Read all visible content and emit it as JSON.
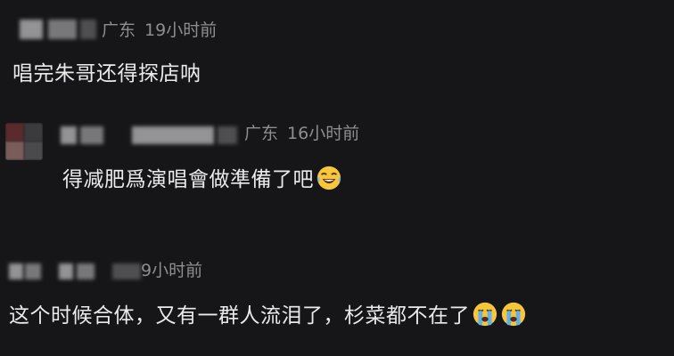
{
  "comments": [
    {
      "location": "广东",
      "time": "19小时前",
      "text": "唱完朱哥还得探店呐"
    },
    {
      "location": "广东",
      "time": "16小时前",
      "text": "得减肥爲演唱會做準備了吧",
      "emoji": "laughing-tears-emoji"
    },
    {
      "time": "9小时前",
      "text": "这个时候合体，又有一群人流泪了，杉菜都不在了",
      "emoji": "crying-emoji"
    }
  ]
}
